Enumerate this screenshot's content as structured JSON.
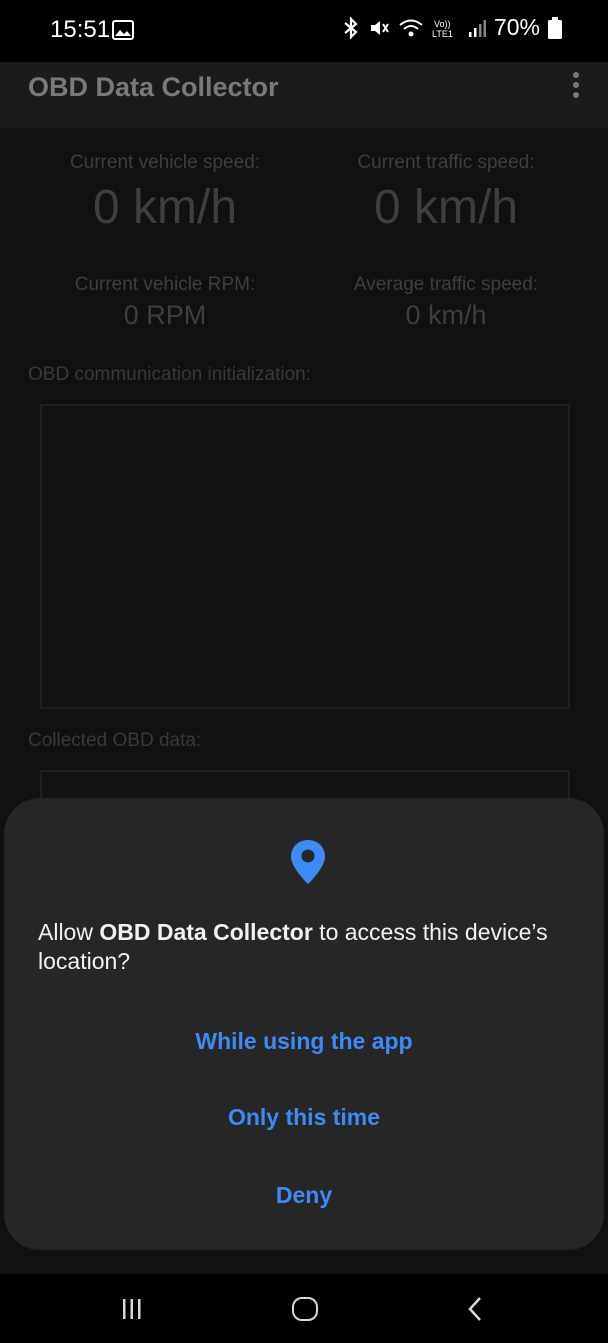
{
  "status_bar": {
    "time": "15:51",
    "battery": "70%",
    "icons": [
      "gallery-icon",
      "bluetooth-icon",
      "mute-icon",
      "wifi-icon",
      "volte-icon",
      "signal-icon",
      "battery-icon"
    ]
  },
  "app_bar": {
    "title": "OBD Data Collector",
    "menu_icon": "overflow-menu-icon"
  },
  "metrics": {
    "vehicle_speed": {
      "label": "Current vehicle speed:",
      "value": "0 km/h"
    },
    "traffic_speed": {
      "label": "Current traffic speed:",
      "value": "0 km/h"
    },
    "vehicle_rpm": {
      "label": "Current vehicle RPM:",
      "value": "0 RPM"
    },
    "avg_traffic_speed": {
      "label": "Average traffic speed:",
      "value": "0 km/h"
    }
  },
  "sections": {
    "init_label": "OBD communication initialization:",
    "collected_label": "Collected OBD data:"
  },
  "dialog": {
    "icon": "location-pin-icon",
    "message_prefix": "Allow ",
    "app_name": "OBD Data Collector",
    "message_suffix": " to access this device’s location?",
    "buttons": {
      "while_using": "While using the app",
      "only_this_time": "Only this time",
      "deny": "Deny"
    }
  },
  "nav_bar": {
    "icons": [
      "recents-icon",
      "home-icon",
      "back-icon"
    ]
  },
  "colors": {
    "accent": "#3d8bf6",
    "dialog_bg": "#262626",
    "dimmed_bg": "#111111"
  }
}
